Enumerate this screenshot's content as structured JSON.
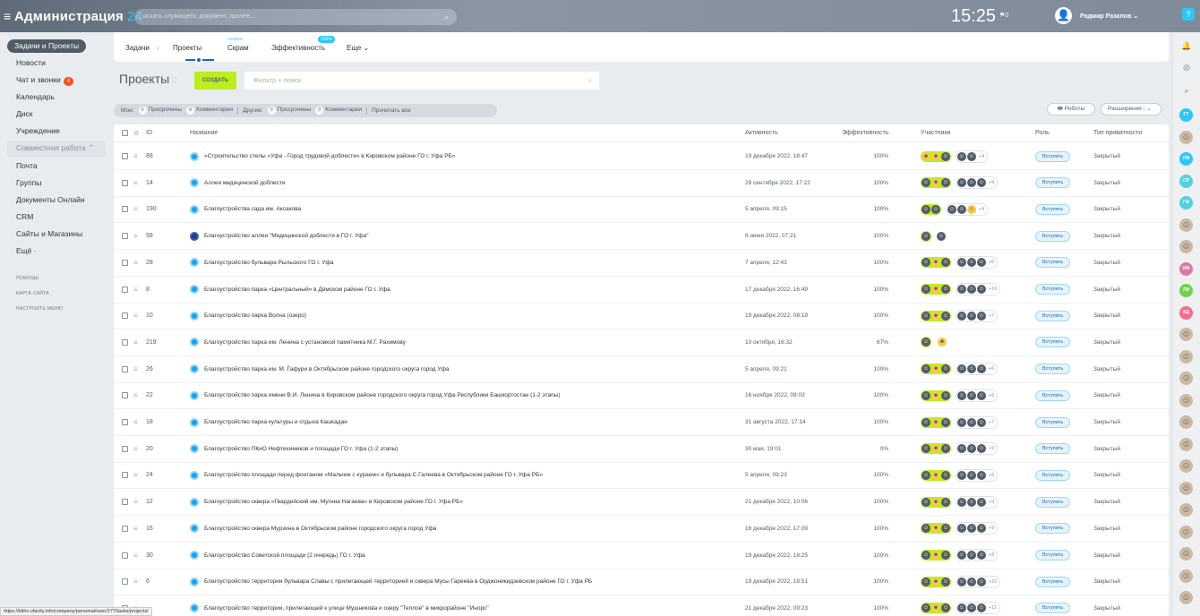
{
  "app": {
    "title": "Администрация",
    "title_suffix": "24",
    "search_placeholder": "искать служащего, документ, прочее...",
    "time": "15:25",
    "flag": "⚑0",
    "user": "Радмир Разапов",
    "help": "?"
  },
  "nav": {
    "items": [
      {
        "label": "Задачи и Проекты",
        "active": true
      },
      {
        "label": "Новости"
      },
      {
        "label": "Чат и звонки",
        "badge": "4"
      },
      {
        "label": "Календарь"
      },
      {
        "label": "Диск"
      },
      {
        "label": "Учреждение"
      }
    ],
    "group_label": "Совместная работа ⌃",
    "group_items": [
      "Почта",
      "Группы",
      "Документы Онлайн",
      "CRM",
      "Сайты и Магазины",
      "Ещё ·"
    ],
    "small": [
      "ПОМОЩЬ",
      "КАРТА САЙТА",
      "НАСТРОИТЬ МЕНЮ"
    ]
  },
  "tabs": {
    "tasks": "Задачи",
    "arrow": "›",
    "projects": "Проекты",
    "scrum": "Скрам",
    "scrum_new": "НОВОЕ",
    "efficiency": "Эффективность",
    "efficiency_pct": "100%",
    "more": "Еще ⌄"
  },
  "toolbar": {
    "title": "Проекты",
    "star": "☆",
    "create": "СОЗДАТЬ",
    "filter_placeholder": "Фильтр + поиск",
    "robots": "Роботы",
    "extensions": "Расширения"
  },
  "counters": {
    "mine": "Мои:",
    "c1": "0",
    "overdue": "Просрочены",
    "c2": "0",
    "comments": "Комментарии",
    "others": "Другие:",
    "c3": "0",
    "overdue2": "Просрочены",
    "c4": "0",
    "comments2": "Комментарии",
    "read_all": "Прочитать все"
  },
  "columns": {
    "id": "ID",
    "name": "Название",
    "activity": "Активность",
    "efficiency": "Эффективность",
    "members": "Участники",
    "role": "Роль",
    "privacy": "Тип приватности"
  },
  "rows": [
    {
      "id": "88",
      "name": "«Строительство стелы «Уфа - Город трудовой доблести» в Кировском районе ГО г. Уфа РБ»",
      "activity": "19 декабря 2022, 18:47",
      "eff": "100%",
      "more": "+4",
      "role": "Вступить",
      "privacy": "Закрытый"
    },
    {
      "id": "14",
      "name": "Аллея медицинской доблести",
      "activity": "28 сентября 2022, 17:22",
      "eff": "100%",
      "more": "+9",
      "role": "Вступить",
      "privacy": "Закрытый"
    },
    {
      "id": "190",
      "name": "Благоустройства сада им. Аксакова",
      "activity": "5 апреля, 09:15",
      "eff": "100%",
      "more": "+4",
      "role": "Вступить",
      "privacy": "Закрытый"
    },
    {
      "id": "58",
      "name": "Благоустройство аллеи \"Медицинской доблести в ГО г. Уфа\"",
      "activity": "8 июня 2022, 07:21",
      "eff": "100%",
      "more": "",
      "role": "Вступить",
      "privacy": "Закрытый"
    },
    {
      "id": "28",
      "name": "Благоустройство бульвара Рыльского ГО г. Уфа",
      "activity": "7 апреля, 12:43",
      "eff": "100%",
      "more": "+6",
      "role": "Вступить",
      "privacy": "Закрытый"
    },
    {
      "id": "8",
      "name": "Благоустройство парка «Центральный» в Дёмском районе ГО г. Уфа",
      "activity": "17 декабря 2022, 16:49",
      "eff": "100%",
      "more": "+10",
      "role": "Вступить",
      "privacy": "Закрытый"
    },
    {
      "id": "10",
      "name": "Благоустройство парка Волна (озеро)",
      "activity": "19 декабря 2022, 08:19",
      "eff": "100%",
      "more": "+7",
      "role": "Вступить",
      "privacy": "Закрытый"
    },
    {
      "id": "219",
      "name": "Благоустройство парка им. Ленина с установкой памятника М.Г. Рахимову",
      "activity": "10 октября, 16:32",
      "eff": "67%",
      "more": "",
      "role": "Вступить",
      "privacy": "Закрытый"
    },
    {
      "id": "26",
      "name": "Благоустройство парка им. М. Гафури в Октябрьском районе городского округа город Уфа",
      "activity": "5 апреля, 09:21",
      "eff": "100%",
      "more": "+6",
      "role": "Вступить",
      "privacy": "Закрытый"
    },
    {
      "id": "22",
      "name": "Благоустройство парка имени В.И. Ленина в Кировском районе городского округа город Уфа Республики Башкортостан (1-2 этапы)",
      "activity": "16 ноября 2022, 09:03",
      "eff": "100%",
      "more": "+6",
      "role": "Вступить",
      "privacy": "Закрытый"
    },
    {
      "id": "18",
      "name": "Благоустройство парка культуры и отдыха Кашкадан",
      "activity": "31 августа 2022, 17:14",
      "eff": "100%",
      "more": "+7",
      "role": "Вступить",
      "privacy": "Закрытый"
    },
    {
      "id": "20",
      "name": "Благоустройство ПКиО Нефтехимиков и площади ГО г. Уфа (1-2 этапы)",
      "activity": "30 мая, 19:01",
      "eff": "0%",
      "more": "+9",
      "role": "Вступить",
      "privacy": "Закрытый"
    },
    {
      "id": "24",
      "name": "Благоустройство площади перед фонтаном «Мальчик с кураем» и бульвара С.Галеева в Октябрьском районе ГО г. Уфа РБ»",
      "activity": "5 апреля, 09:23",
      "eff": "100%",
      "more": "+6",
      "role": "Вступить",
      "privacy": "Закрытый"
    },
    {
      "id": "12",
      "name": "Благоустройство сквера «Гвардейский им. Мугина Нагаева» в Кировском районе ГО г. Уфа РБ»",
      "activity": "21 декабря 2022, 10:06",
      "eff": "100%",
      "more": "+9",
      "role": "Вступить",
      "privacy": "Закрытый"
    },
    {
      "id": "16",
      "name": "Благоустройство сквера Мурзина в Октябрьском районе городского округа город Уфа",
      "activity": "16 декабря 2022, 17:09",
      "eff": "100%",
      "more": "+9",
      "role": "Вступить",
      "privacy": "Закрытый"
    },
    {
      "id": "30",
      "name": "Благоустройство Советской площади (2 очередь) ГО г. Уфа",
      "activity": "19 декабря 2022, 18:25",
      "eff": "100%",
      "more": "+8",
      "role": "Вступить",
      "privacy": "Закрытый"
    },
    {
      "id": "6",
      "name": "Благоустройство территории бульвара Славы с прилегающей территорией и сквера Мусы Гареева в Орджоникидзевском районе ГО г. Уфа РБ",
      "activity": "19 декабря 2022, 18:51",
      "eff": "100%",
      "more": "+10",
      "role": "Вступить",
      "privacy": "Закрытый"
    },
    {
      "id": "",
      "name": "Благоустройство территории, прилегающей к улице Мушникова и озеру \"Теплое\" в микрорайоне \"Инорс\"",
      "activity": "21 декабря 2022, 09:23",
      "eff": "100%",
      "more": "+11",
      "role": "Вступить",
      "privacy": "Закрытый"
    }
  ],
  "rightbar": {
    "avatars": [
      "ГТ",
      "ЛФ",
      "СР",
      "ГФ",
      "ИФ",
      "ЛИ",
      "ВД"
    ]
  },
  "status_url": "https://bitrix.ufacity.info/company/personal/user/277/tasks/projects/"
}
